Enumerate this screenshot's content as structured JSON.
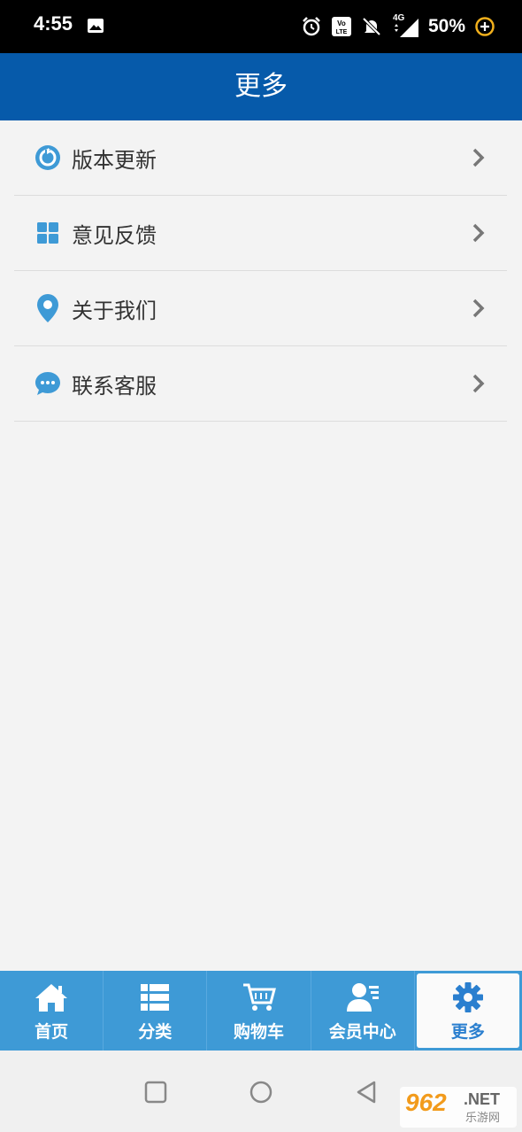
{
  "status_bar": {
    "time": "4:55",
    "battery": "50%",
    "icons": [
      "image-icon",
      "alarm-icon",
      "volte-icon",
      "mute-icon",
      "signal-4g-icon",
      "battery-saver-icon"
    ],
    "network_label": "4G"
  },
  "header": {
    "title": "更多"
  },
  "menu": {
    "items": [
      {
        "label": "版本更新",
        "icon": "refresh-globe-icon"
      },
      {
        "label": "意见反馈",
        "icon": "grid-icon"
      },
      {
        "label": "关于我们",
        "icon": "location-pin-icon"
      },
      {
        "label": "联系客服",
        "icon": "chat-bubble-icon"
      }
    ]
  },
  "tabs": [
    {
      "label": "首页",
      "icon": "home-icon",
      "active": false
    },
    {
      "label": "分类",
      "icon": "list-icon",
      "active": false
    },
    {
      "label": "购物车",
      "icon": "cart-icon",
      "active": false
    },
    {
      "label": "会员中心",
      "icon": "member-icon",
      "active": false
    },
    {
      "label": "更多",
      "icon": "gear-icon",
      "active": true
    }
  ],
  "watermark": {
    "main": "962",
    "suffix": ".NET",
    "sub": "乐游网"
  },
  "colors": {
    "header_bg": "#065aaa",
    "tab_bg": "#3e9ad6",
    "icon_blue": "#3e9ad6",
    "page_bg": "#f3f3f3"
  }
}
